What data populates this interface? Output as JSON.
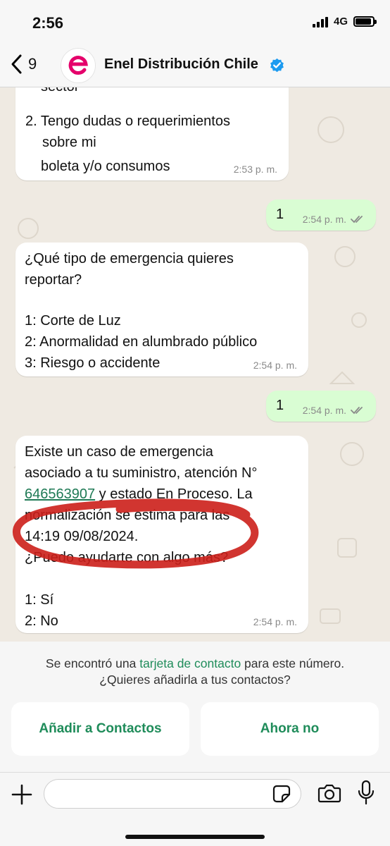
{
  "status_bar": {
    "time": "2:56",
    "network": "4G",
    "battery_level": 0.9
  },
  "header": {
    "back_count": "9",
    "contact_name": "Enel Distribución Chile",
    "avatar_letter": "e",
    "verified_icon": "verified-badge-icon",
    "brand_color": "#e5006b"
  },
  "messages": {
    "m1": {
      "cut_text": "sector",
      "line_a": "2. Tengo dudas o requerimientos",
      "line_b": "sobre mi",
      "line_c": "boleta y/o consumos",
      "time": "2:53 p. m."
    },
    "m2": {
      "text": "1",
      "time": "2:54 p. m."
    },
    "m3": {
      "line_a": "¿Qué tipo de emergencia quieres",
      "line_b": "reportar?",
      "line_c": "1: Corte de Luz",
      "line_d": "2: Anormalidad en alumbrado público",
      "line_e": "3: Riesgo o accidente",
      "time": "2:54 p. m."
    },
    "m4": {
      "text": "1",
      "time": "2:54 p. m."
    },
    "m5": {
      "line_a": "Existe un caso de emergencia",
      "line_b": "asociado a tu suministro, atención N°",
      "case_number": "646563907",
      "line_c_rest": " y estado En Proceso. La",
      "line_d": "normalización se estima para las",
      "line_e": "14:19 09/08/2024.",
      "line_f": "¿Puedo ayudarte con algo más?",
      "option_1": "1: Sí",
      "option_2": "2: No",
      "time": "2:54 p. m."
    }
  },
  "contact_banner": {
    "prefix": "Se encontró una ",
    "link": "tarjeta de contacto",
    "suffix": " para este número.",
    "line2": "¿Quieres añadirla a tus contactos?",
    "add_button": "Añadir a Contactos",
    "dismiss_button": "Ahora no"
  },
  "composer": {
    "placeholder": "",
    "accent": "#1f8c5a"
  },
  "colors": {
    "chat_background": "#efeae2",
    "incoming_bubble": "#ffffff",
    "outgoing_bubble": "#d9fdd3",
    "annotation_red": "#cc1f1a"
  }
}
